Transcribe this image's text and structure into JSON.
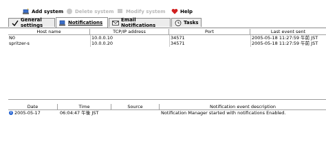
{
  "toolbar": {
    "add_system": "Add system",
    "delete_system": "Delete system",
    "modify_system": "Modify system",
    "help": "Help"
  },
  "tabs": [
    {
      "label": "General settings",
      "active": false
    },
    {
      "label": "Notifications",
      "active": true
    },
    {
      "label": "Email Notifications",
      "active": false
    },
    {
      "label": "Tasks",
      "active": false
    }
  ],
  "systems_table": {
    "columns": [
      "Host name",
      "TCP/IP address",
      "Port",
      "Last event sent"
    ],
    "rows": [
      [
        "N0",
        "10.0.0.10",
        "34571",
        "2005-05-18 11:27:59 午前 JST"
      ],
      [
        "spritzer-s",
        "10.0.0.20",
        "34571",
        "2005-05-18 11:27:59 午前 JST"
      ]
    ]
  },
  "events_table": {
    "columns": [
      "Date",
      "Time",
      "Source",
      "Notification event description"
    ],
    "rows": [
      [
        "2005-05-17",
        "06:04:47 午後 JST",
        "",
        "Notification Manager started with notifications Enabled."
      ]
    ]
  },
  "colors": {
    "accent_blue": "#1f5fd0",
    "help_red": "#d02020",
    "tab_border": "#8a8a8a"
  }
}
